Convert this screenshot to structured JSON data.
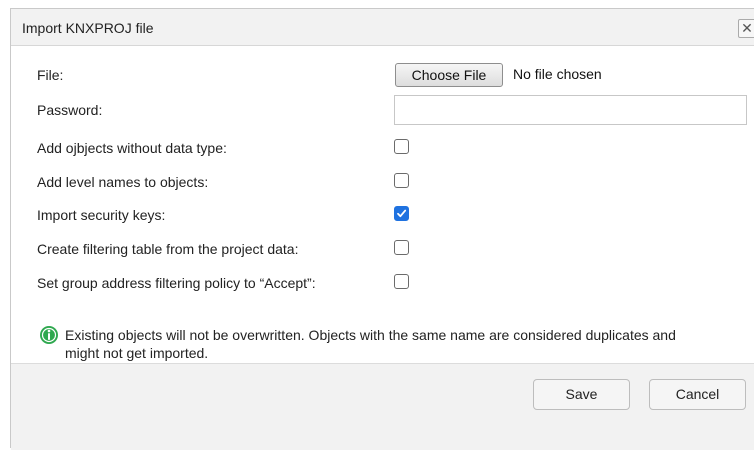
{
  "dialog": {
    "title": "Import KNXPROJ file",
    "close_symbol": "✕"
  },
  "form": {
    "file_label": "File:",
    "choose_file_label": "Choose File",
    "file_status": "No file chosen",
    "password_label": "Password:",
    "password_value": "",
    "options": [
      {
        "label": "Add ojbjects without data type:",
        "checked": false
      },
      {
        "label": "Add level names to objects:",
        "checked": false
      },
      {
        "label": "Import security keys:",
        "checked": true
      },
      {
        "label": "Create filtering table from the project data:",
        "checked": false
      },
      {
        "label": "Set group address filtering policy to “Accept”:",
        "checked": false
      }
    ]
  },
  "notice": {
    "icon": "info-icon",
    "text": "Existing objects will not be overwritten. Objects with the same name are considered duplicates and might not get imported."
  },
  "footer": {
    "save_label": "Save",
    "cancel_label": "Cancel"
  },
  "colors": {
    "accent": "#1f72e0",
    "notice_icon": "#2fa84f"
  }
}
